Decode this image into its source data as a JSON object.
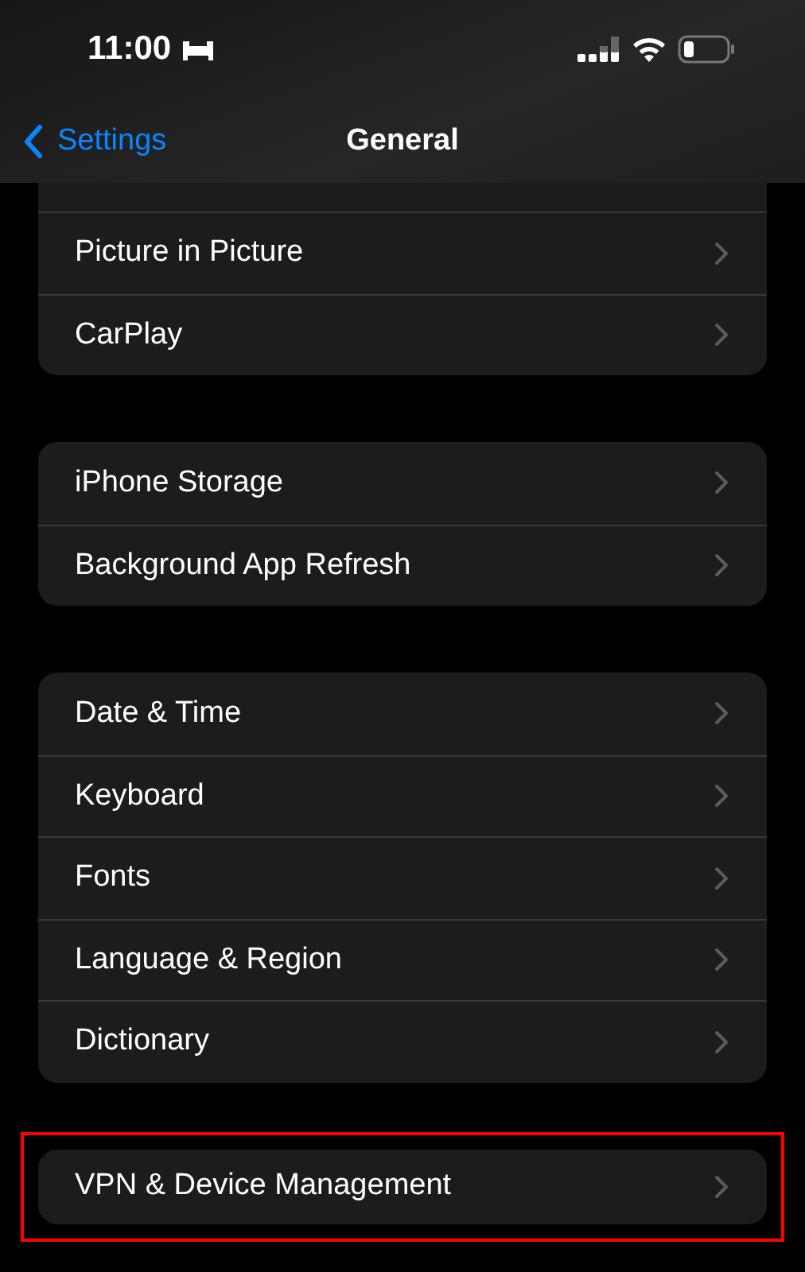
{
  "status_bar": {
    "time": "11:00"
  },
  "nav": {
    "back": "Settings",
    "title": "General"
  },
  "groups": [
    {
      "cut_off_above": true,
      "items": [
        {
          "label": "Picture in Picture",
          "highlighted": false
        },
        {
          "label": "CarPlay",
          "highlighted": false
        }
      ]
    },
    {
      "cut_off_above": false,
      "items": [
        {
          "label": "iPhone Storage",
          "highlighted": false
        },
        {
          "label": "Background App Refresh",
          "highlighted": false
        }
      ]
    },
    {
      "cut_off_above": false,
      "items": [
        {
          "label": "Date & Time",
          "highlighted": false
        },
        {
          "label": "Keyboard",
          "highlighted": false
        },
        {
          "label": "Fonts",
          "highlighted": false
        },
        {
          "label": "Language & Region",
          "highlighted": false
        },
        {
          "label": "Dictionary",
          "highlighted": false
        }
      ]
    },
    {
      "cut_off_above": false,
      "items": [
        {
          "label": "VPN & Device Management",
          "highlighted": true
        }
      ]
    }
  ]
}
